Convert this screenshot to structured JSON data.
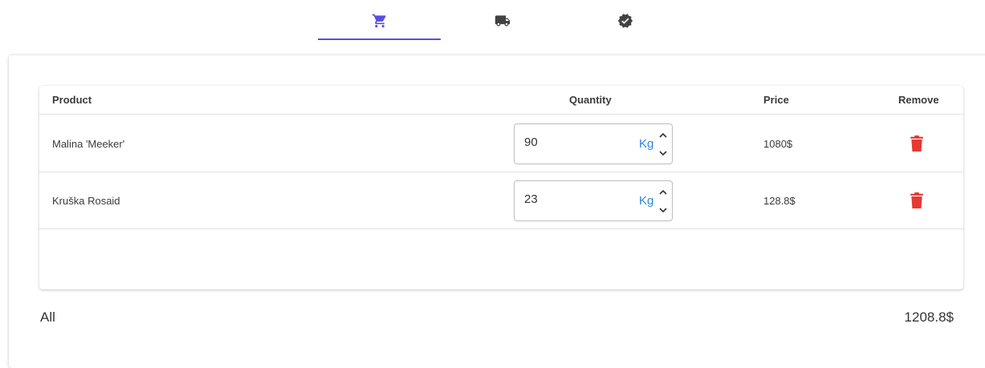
{
  "stepper": {
    "steps": [
      {
        "icon": "cart-icon",
        "active": true
      },
      {
        "icon": "truck-icon",
        "active": false
      },
      {
        "icon": "verified-check-icon",
        "active": false
      }
    ],
    "accent_color": "#5b4ee0"
  },
  "table": {
    "headers": {
      "product": "Product",
      "quantity": "Quantity",
      "price": "Price",
      "remove": "Remove"
    },
    "rows": [
      {
        "product": "Malina 'Meeker'",
        "quantity": "90",
        "unit": "Kg",
        "price": "1080$"
      },
      {
        "product": "Kruška Rosaid",
        "quantity": "23",
        "unit": "Kg",
        "price": "128.8$"
      }
    ]
  },
  "summary": {
    "label": "All",
    "total": "1208.8$"
  },
  "colors": {
    "unit": "#2f86d6",
    "delete": "#e53935"
  }
}
